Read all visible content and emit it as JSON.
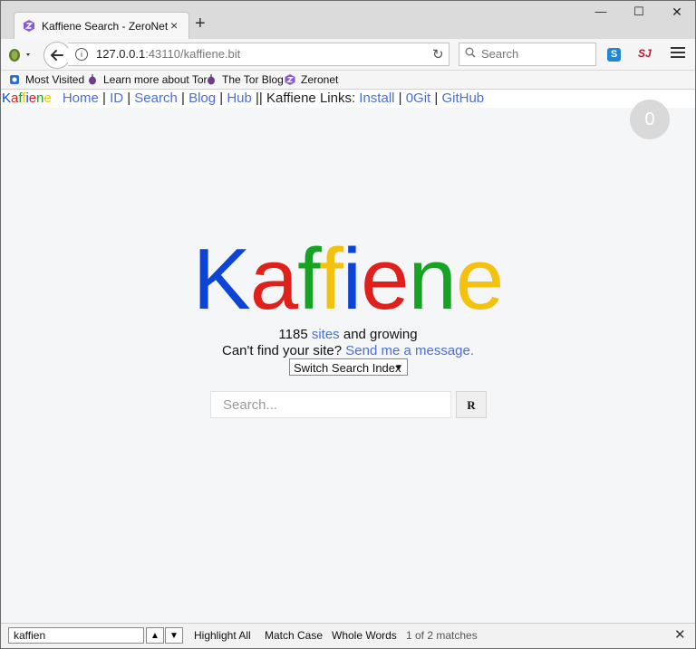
{
  "tab": {
    "title": "Kaffiene Search - ZeroNet",
    "close": "×",
    "new_tab": "+"
  },
  "window_controls": {
    "minimize": "—",
    "maximize": "☐",
    "close": "✕"
  },
  "address": {
    "host": "127.0.0.1",
    "rest": ":43110/kaffiene.bit"
  },
  "search_bar": {
    "placeholder": "Search"
  },
  "extensions": {
    "s": "S",
    "sj": "SJ"
  },
  "bookmarks": [
    {
      "label": "Most Visited"
    },
    {
      "label": "Learn more about Tor"
    },
    {
      "label": "The Tor Blog"
    },
    {
      "label": "Zeronet"
    }
  ],
  "page": {
    "brand_small": [
      "K",
      "a",
      "f",
      "f",
      "i",
      "e",
      "n",
      "e"
    ],
    "nav": {
      "home": "Home",
      "id": "ID",
      "search": "Search",
      "blog": "Blog",
      "hub": "Hub",
      "sep": " | ",
      "dsep": " || ",
      "links_label": "Kaffiene Links:",
      "install": "Install",
      "zerogit": "0Git",
      "github": "GitHub"
    },
    "badge": "0",
    "logo_letters": [
      "K",
      "a",
      "f",
      "f",
      "i",
      "e",
      "n",
      "e"
    ],
    "logo_colors": [
      "#0b44d6",
      "#e0201b",
      "#16a324",
      "#f4c20d",
      "#0b44d6",
      "#e0201b",
      "#16a324",
      "#f4c20d"
    ],
    "stats": {
      "count": "1185",
      "link": "sites",
      "suffix": "and growing"
    },
    "help": {
      "prefix": "Can't find your site?",
      "link": "Send me a message."
    },
    "index_select": "Switch Search Index",
    "search_placeholder": "Search...",
    "search_button": "R"
  },
  "findbar": {
    "value": "kaffien",
    "highlight_all": "Highlight All",
    "match_case": "Match Case",
    "whole_words": "Whole Words",
    "status": "1 of 2 matches",
    "close": "✕"
  }
}
